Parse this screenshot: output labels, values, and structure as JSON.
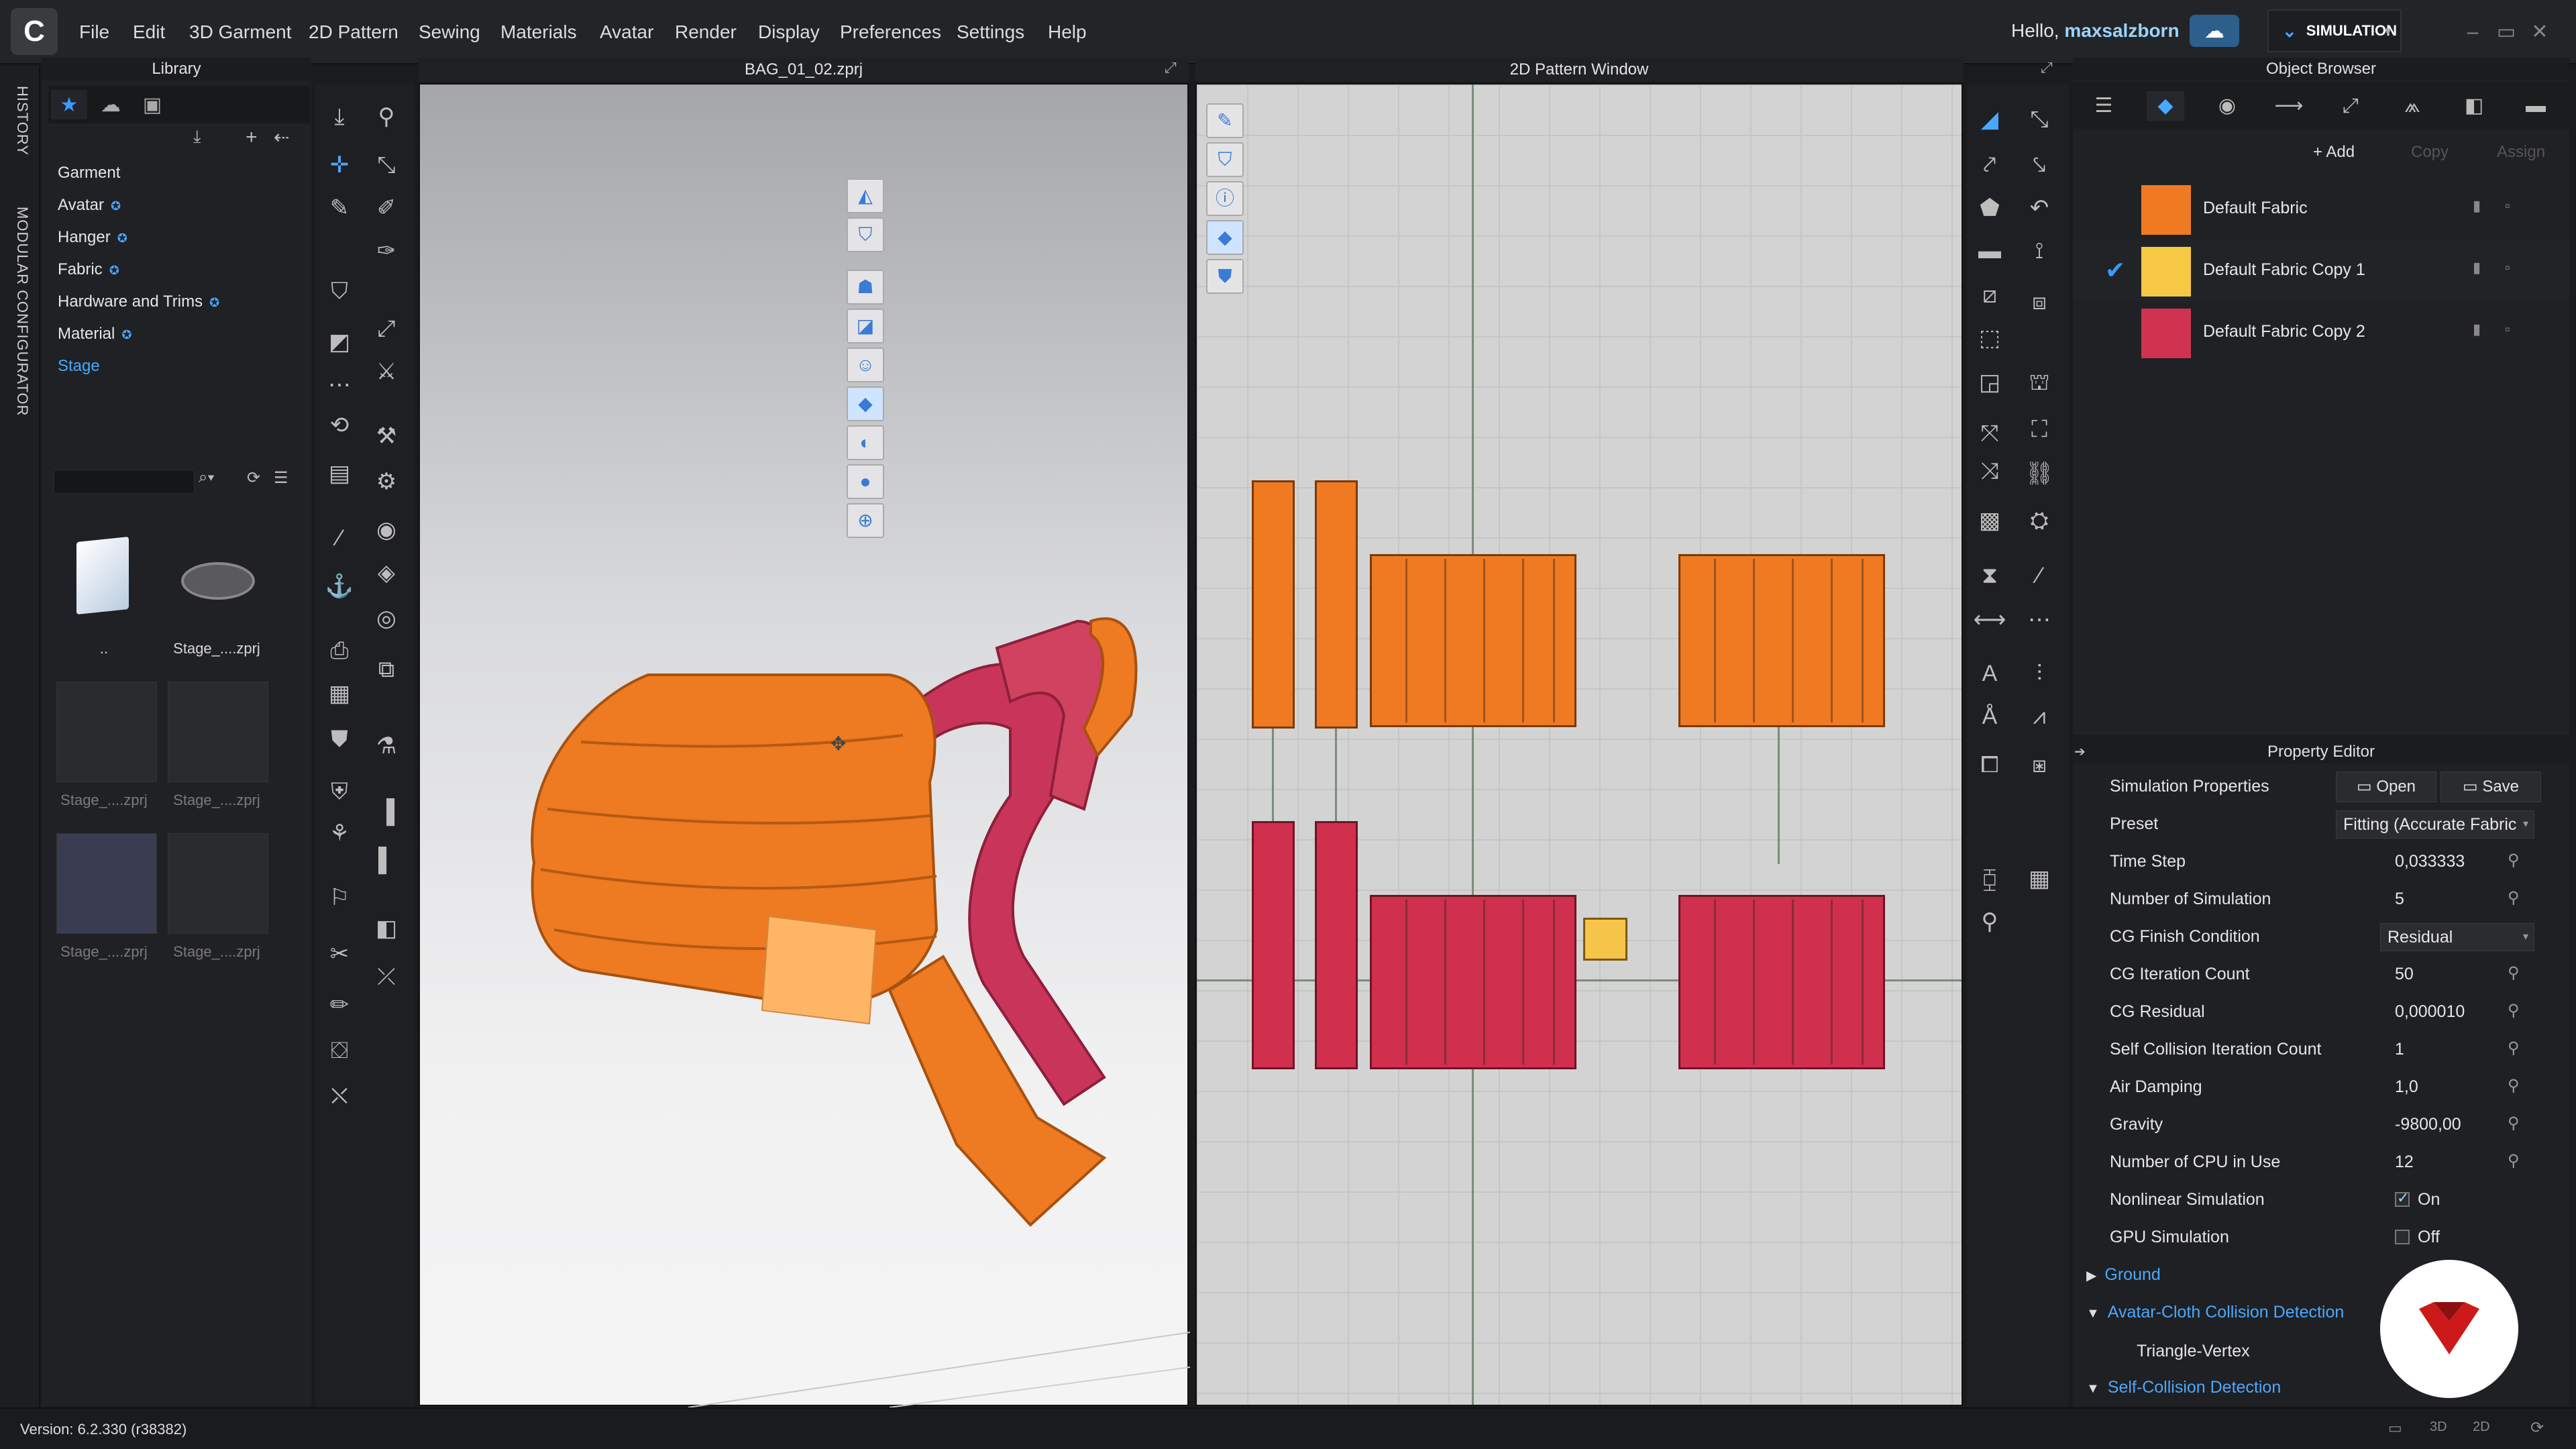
{
  "menubar": {
    "items": [
      "File",
      "Edit",
      "3D Garment",
      "2D Pattern",
      "Sewing",
      "Materials",
      "Avatar",
      "Render",
      "Display",
      "Preferences",
      "Settings",
      "Help"
    ],
    "greeting_prefix": "Hello, ",
    "username": "maxsalzborn",
    "mode": "SIMULATION",
    "window_controls": [
      "–",
      "▭",
      "✕"
    ]
  },
  "side_strip": {
    "history": "HISTORY",
    "modular": "MODULAR CONFIGURATOR"
  },
  "library": {
    "title": "Library",
    "items": [
      {
        "label": "Garment",
        "sync": false
      },
      {
        "label": "Avatar",
        "sync": true
      },
      {
        "label": "Hanger",
        "sync": true
      },
      {
        "label": "Fabric",
        "sync": true
      },
      {
        "label": "Hardware and Trims",
        "sync": true
      },
      {
        "label": "Material",
        "sync": true
      },
      {
        "label": "Stage",
        "sync": false,
        "active": true
      }
    ],
    "files": [
      "..",
      "Stage_....zprj",
      "Stage_....zprj",
      "Stage_....zprj",
      "Stage_....zprj",
      "Stage_....zprj"
    ]
  },
  "viewport3d": {
    "title": "BAG_01_02.zprj"
  },
  "viewport2d": {
    "title": "2D Pattern Window"
  },
  "object_browser": {
    "title": "Object Browser",
    "add": "+ Add",
    "copy": "Copy",
    "assign": "Assign",
    "fabrics": [
      {
        "name": "Default Fabric",
        "color": "#ef7a22",
        "selected": false
      },
      {
        "name": "Default Fabric Copy 1",
        "color": "#f7c844",
        "selected": true
      },
      {
        "name": "Default Fabric Copy 2",
        "color": "#cf3350",
        "selected": false
      }
    ]
  },
  "property_editor": {
    "title": "Property Editor",
    "header_label": "Simulation Properties",
    "open": "Open",
    "save": "Save",
    "rows": {
      "preset": {
        "label": "Preset",
        "value": "Fitting (Accurate Fabric"
      },
      "time_step": {
        "label": "Time Step",
        "value": "0,033333"
      },
      "num_sim": {
        "label": "Number of Simulation",
        "value": "5"
      },
      "cg_finish": {
        "label": "CG Finish Condition",
        "value": "Residual"
      },
      "cg_iter": {
        "label": "CG Iteration Count",
        "value": "50"
      },
      "cg_resid": {
        "label": "CG Residual",
        "value": "0,000010"
      },
      "self_coll": {
        "label": "Self Collision Iteration Count",
        "value": "1"
      },
      "air_damp": {
        "label": "Air Damping",
        "value": "1,0"
      },
      "gravity": {
        "label": "Gravity",
        "value": "-9800,00"
      },
      "cpu": {
        "label": "Number of CPU in Use",
        "value": "12"
      },
      "nonlinear": {
        "label": "Nonlinear Simulation",
        "value": "On",
        "checked": true
      },
      "gpu": {
        "label": "GPU Simulation",
        "value": "Off",
        "checked": false
      }
    },
    "sections": {
      "ground": "Ground",
      "avatar_cloth": "Avatar-Cloth Collision Detection",
      "triangle_vertex": "Triangle-Vertex",
      "self_collision": "Self-Collision Detection"
    }
  },
  "status": {
    "version": "Version: 6.2.330 (r38382)"
  },
  "colors": {
    "accent": "#4aa8ff",
    "orange": "#ef7a22",
    "red": "#cf3350",
    "yellow": "#f7c844"
  }
}
